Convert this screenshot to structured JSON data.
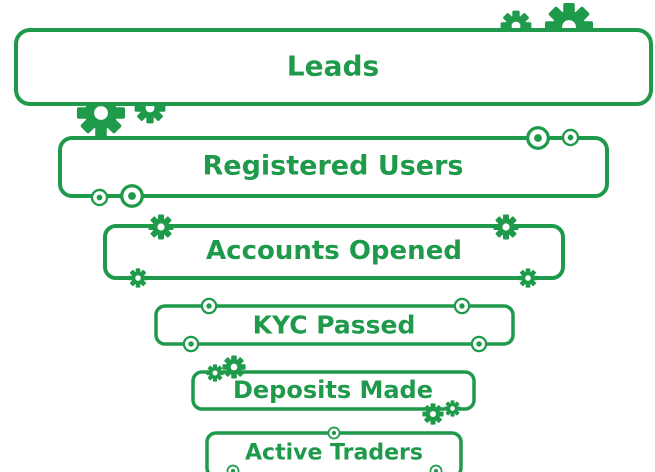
{
  "funnel": {
    "accent_color": "#1f9a4b",
    "stages": [
      {
        "label": "Leads"
      },
      {
        "label": "Registered Users"
      },
      {
        "label": "Accounts Opened"
      },
      {
        "label": "KYC Passed"
      },
      {
        "label": "Deposits Made"
      },
      {
        "label": "Active Traders"
      }
    ],
    "decorations": [
      "gear-icon",
      "ring-node-icon"
    ]
  }
}
